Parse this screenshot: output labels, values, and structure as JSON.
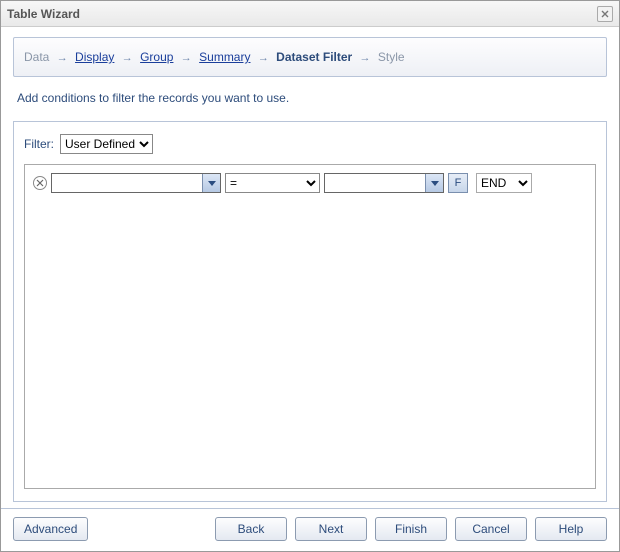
{
  "window": {
    "title": "Table Wizard"
  },
  "breadcrumb": {
    "data": "Data",
    "display": "Display",
    "group": "Group",
    "summary": "Summary",
    "dataset_filter": "Dataset Filter",
    "style": "Style"
  },
  "description": "Add conditions to filter the records you want to use.",
  "filter": {
    "label": "Filter:",
    "value": "User Defined"
  },
  "condition": {
    "operator": "=",
    "f_label": "F",
    "logic": "END"
  },
  "buttons": {
    "advanced": "Advanced",
    "back": "Back",
    "next": "Next",
    "finish": "Finish",
    "cancel": "Cancel",
    "help": "Help"
  }
}
